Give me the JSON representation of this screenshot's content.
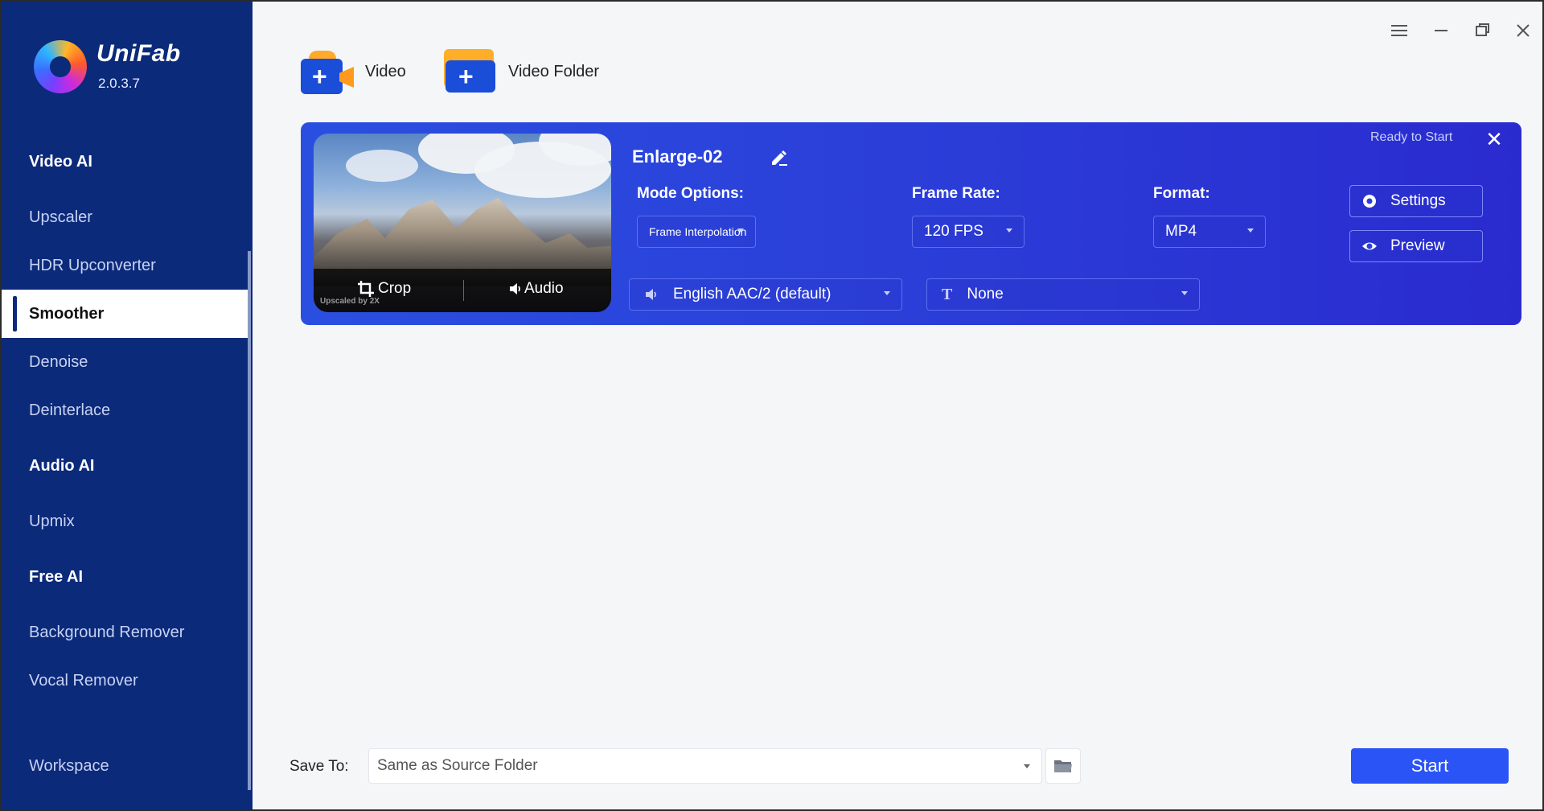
{
  "app": {
    "brand": "UniFab",
    "version": "2.0.3.7"
  },
  "sidebar": {
    "groups": [
      {
        "label": "Video AI"
      },
      {
        "label": "Audio AI"
      },
      {
        "label": "Free AI"
      }
    ],
    "items": [
      {
        "label": "Upscaler"
      },
      {
        "label": "HDR Upconverter"
      },
      {
        "label": "Smoother",
        "active": true
      },
      {
        "label": "Denoise"
      },
      {
        "label": "Deinterlace"
      },
      {
        "label": "Upmix"
      },
      {
        "label": "Background Remover"
      },
      {
        "label": "Vocal Remover"
      },
      {
        "label": "Workspace"
      }
    ]
  },
  "toolbar": {
    "add_video_label": "Video",
    "add_folder_label": "Video Folder"
  },
  "task": {
    "title": "Enlarge-02",
    "status": "Ready to Start",
    "thumb": {
      "crop_label": "Crop",
      "audio_label": "Audio",
      "upscaled_label": "Upscaled by 2X"
    },
    "mode_label": "Mode Options:",
    "mode_value": "Frame Interpolation",
    "frame_rate_label": "Frame Rate:",
    "frame_rate_value": "120 FPS",
    "format_label": "Format:",
    "format_value": "MP4",
    "audio_track": "English AAC/2 (default)",
    "subtitle": "None",
    "settings_label": "Settings",
    "preview_label": "Preview"
  },
  "bottom": {
    "save_to_label": "Save To:",
    "save_to_value": "Same as Source Folder",
    "start_label": "Start"
  },
  "colors": {
    "sidebar_bg": "#0b2a7a",
    "card_bg": "#2b3ed8",
    "accent": "#2a54f5"
  }
}
